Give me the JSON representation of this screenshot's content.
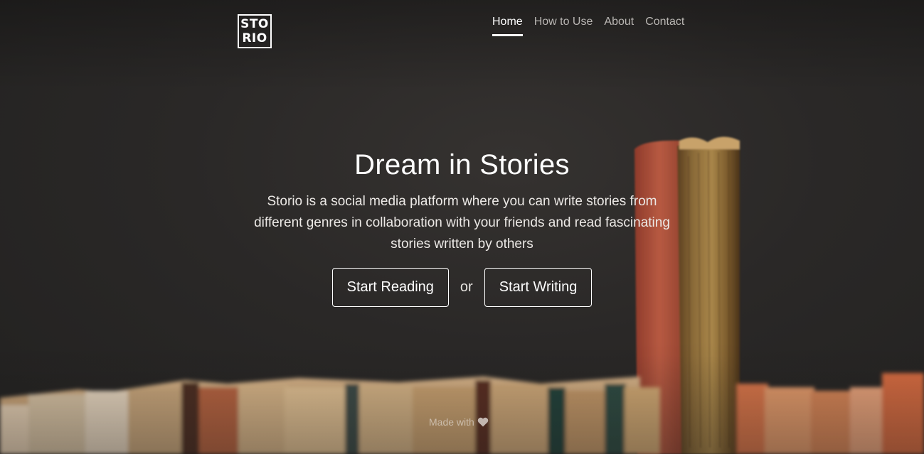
{
  "logo": {
    "line1": "STO",
    "line2": "RIO"
  },
  "nav": {
    "items": [
      {
        "label": "Home",
        "active": true
      },
      {
        "label": "How to Use",
        "active": false
      },
      {
        "label": "About",
        "active": false
      },
      {
        "label": "Contact",
        "active": false
      }
    ]
  },
  "hero": {
    "title": "Dream in Stories",
    "description": "Storio is a social media platform where you can write stories from different genres in collaboration with your friends and read fascinating stories written by others",
    "primary_button": "Start Reading",
    "separator": "or",
    "secondary_button": "Start Writing"
  },
  "footer": {
    "made_with": "Made with",
    "icon": "heart-icon"
  },
  "colors": {
    "background": "#2a2827",
    "text": "#ffffff",
    "nav_inactive": "#b9b6b3"
  }
}
